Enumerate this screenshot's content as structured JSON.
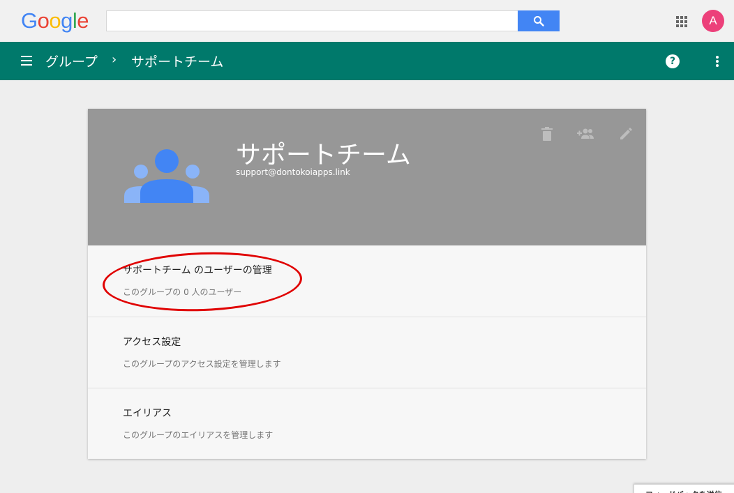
{
  "logo": {
    "letters": [
      "G",
      "o",
      "o",
      "g",
      "l",
      "e"
    ],
    "colors": [
      "#4285f4",
      "#ea4335",
      "#fbbc05",
      "#4285f4",
      "#34a853",
      "#ea4335"
    ]
  },
  "search": {
    "value": "",
    "placeholder": ""
  },
  "user": {
    "avatar_letter": "A",
    "avatar_color": "#ec407a"
  },
  "appbar": {
    "crumb_root": "グループ",
    "separator": "›",
    "crumb_current": "サポートチーム",
    "color": "#00796b"
  },
  "group": {
    "name": "サポートチーム",
    "email": "support@dontokoiapps.link",
    "header_color": "#979797",
    "actions": [
      "delete-icon",
      "add-people-icon",
      "edit-icon"
    ]
  },
  "rows": [
    {
      "title": "サポートチーム のユーザーの管理",
      "subtitle": "このグループの 0 人のユーザー"
    },
    {
      "title": "アクセス設定",
      "subtitle": "このグループのアクセス設定を管理します"
    },
    {
      "title": "エイリアス",
      "subtitle": "このグループのエイリアスを管理します"
    }
  ],
  "feedback": {
    "label": "フィードバックを送信"
  },
  "annotation_color": "#e00000"
}
